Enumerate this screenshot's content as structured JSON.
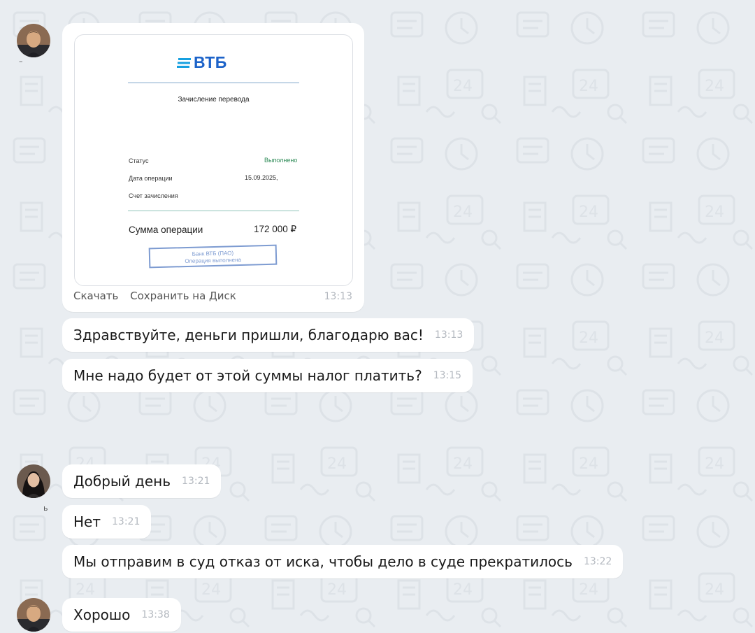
{
  "document_message": {
    "bank_name": "ВТБ",
    "doc_title": "Зачисление перевода",
    "fields": [
      {
        "label": "Статус",
        "value": "Выполнено"
      },
      {
        "label": "Дата операции",
        "value": "15.09.2025,"
      },
      {
        "label": "Счет зачисления",
        "value": ""
      }
    ],
    "sum_label": "Сумма операции",
    "sum_value": "172 000 ₽",
    "stamp_line1": "Банк ВТБ (ПАО)",
    "stamp_line2": "Операция выполнена",
    "action_download": "Скачать",
    "action_save": "Сохранить на Диск",
    "time": "13:13"
  },
  "sender1_mark": "–",
  "sender2_mark": "ь",
  "messages": [
    {
      "text": "Здравствуйте, деньги пришли, благодарю вас!",
      "time": "13:13"
    },
    {
      "text": "Мне надо будет от этой суммы налог платить?",
      "time": "13:15"
    },
    {
      "text": "Добрый день",
      "time": "13:21"
    },
    {
      "text": "Нет",
      "time": "13:21"
    },
    {
      "text": "Мы отправим в суд отказ от иска, чтобы дело в суде прекратилось",
      "time": "13:22"
    },
    {
      "text": "Хорошо",
      "time": "13:38"
    }
  ],
  "colors": {
    "background": "#e9edf1",
    "bubble": "#ffffff",
    "bank_brand": "#1d63c9",
    "status_green": "#2e8b57",
    "timestamp": "#b3b8bf"
  }
}
